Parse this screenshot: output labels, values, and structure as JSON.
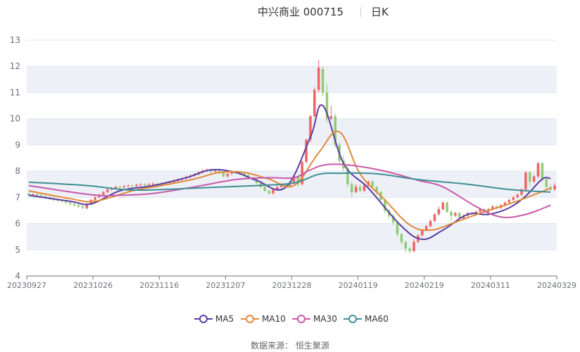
{
  "title": "中兴商业 000715",
  "subtitle": "日K",
  "source": "数据来源： 恒生聚源",
  "colors": {
    "up": "#ee6666",
    "down": "#91cc75",
    "MA5": "#5b3da1",
    "MA10": "#e08a3b",
    "MA30": "#c85aaa",
    "MA60": "#3f8f96",
    "band": "#eef0f7",
    "grid": "#e0e6f1",
    "axis": "#6e7079"
  },
  "chart_data": {
    "type": "candlestick",
    "ylim": [
      4,
      13
    ],
    "yticks": [
      4,
      5,
      6,
      7,
      8,
      9,
      10,
      11,
      12,
      13
    ],
    "xticks": [
      "20230927",
      "20231026",
      "20231116",
      "20231207",
      "20231228",
      "20240119",
      "20240219",
      "20240311",
      "20240329"
    ],
    "grid": true,
    "legend_position": "bottom",
    "candles": [
      [
        7.15,
        7.1,
        7.18,
        7.05
      ],
      [
        7.1,
        7.12,
        7.16,
        7.05
      ],
      [
        7.12,
        7.08,
        7.15,
        7.02
      ],
      [
        7.08,
        7.05,
        7.12,
        7.0
      ],
      [
        7.05,
        7.0,
        7.08,
        6.95
      ],
      [
        7.0,
        6.95,
        7.05,
        6.9
      ],
      [
        6.95,
        6.9,
        7.0,
        6.85
      ],
      [
        6.9,
        6.88,
        6.95,
        6.82
      ],
      [
        6.88,
        6.85,
        6.92,
        6.8
      ],
      [
        6.85,
        6.8,
        6.9,
        6.75
      ],
      [
        6.8,
        6.75,
        6.85,
        6.7
      ],
      [
        6.75,
        6.7,
        6.8,
        6.65
      ],
      [
        6.7,
        6.65,
        6.75,
        6.6
      ],
      [
        6.65,
        6.6,
        6.7,
        6.55
      ],
      [
        6.58,
        6.75,
        6.8,
        6.55
      ],
      [
        6.75,
        6.9,
        6.95,
        6.7
      ],
      [
        6.9,
        7.0,
        7.05,
        6.85
      ],
      [
        7.0,
        7.1,
        7.15,
        6.95
      ],
      [
        7.1,
        7.2,
        7.25,
        7.05
      ],
      [
        7.2,
        7.3,
        7.35,
        7.15
      ],
      [
        7.3,
        7.35,
        7.4,
        7.25
      ],
      [
        7.35,
        7.4,
        7.45,
        7.3
      ],
      [
        7.4,
        7.38,
        7.45,
        7.33
      ],
      [
        7.38,
        7.42,
        7.48,
        7.33
      ],
      [
        7.42,
        7.45,
        7.5,
        7.38
      ],
      [
        7.45,
        7.43,
        7.5,
        7.38
      ],
      [
        7.43,
        7.48,
        7.52,
        7.4
      ],
      [
        7.48,
        7.5,
        7.55,
        7.43
      ],
      [
        7.5,
        7.47,
        7.55,
        7.42
      ],
      [
        7.47,
        7.5,
        7.55,
        7.43
      ],
      [
        7.5,
        7.52,
        7.58,
        7.45
      ],
      [
        7.52,
        7.48,
        7.56,
        7.44
      ],
      [
        7.48,
        7.52,
        7.56,
        7.45
      ],
      [
        7.52,
        7.55,
        7.6,
        7.48
      ],
      [
        7.55,
        7.58,
        7.63,
        7.5
      ],
      [
        7.58,
        7.62,
        7.68,
        7.53
      ],
      [
        7.62,
        7.68,
        7.72,
        7.57
      ],
      [
        7.68,
        7.72,
        7.78,
        7.62
      ],
      [
        7.72,
        7.78,
        7.83,
        7.67
      ],
      [
        7.78,
        7.82,
        7.88,
        7.73
      ],
      [
        7.82,
        7.88,
        7.93,
        7.77
      ],
      [
        7.88,
        7.95,
        8.0,
        7.83
      ],
      [
        7.95,
        8.02,
        8.07,
        7.9
      ],
      [
        8.02,
        8.05,
        8.1,
        7.97
      ],
      [
        8.05,
        7.98,
        8.1,
        7.93
      ],
      [
        7.98,
        8.02,
        8.08,
        7.93
      ],
      [
        8.02,
        7.95,
        8.07,
        7.88
      ],
      [
        7.95,
        7.8,
        7.98,
        7.75
      ],
      [
        7.8,
        7.9,
        7.95,
        7.75
      ],
      [
        7.9,
        7.98,
        8.03,
        7.85
      ],
      [
        7.98,
        7.95,
        8.02,
        7.9
      ],
      [
        7.95,
        7.9,
        8.0,
        7.85
      ],
      [
        7.9,
        7.85,
        7.95,
        7.8
      ],
      [
        7.85,
        7.75,
        7.9,
        7.7
      ],
      [
        7.75,
        7.7,
        7.8,
        7.65
      ],
      [
        7.7,
        7.55,
        7.75,
        7.5
      ],
      [
        7.55,
        7.4,
        7.6,
        7.35
      ],
      [
        7.4,
        7.25,
        7.45,
        7.2
      ],
      [
        7.25,
        7.15,
        7.3,
        7.1
      ],
      [
        7.15,
        7.3,
        7.35,
        7.1
      ],
      [
        7.3,
        7.4,
        7.45,
        7.25
      ],
      [
        7.4,
        7.5,
        7.55,
        7.35
      ],
      [
        7.5,
        7.45,
        7.55,
        7.4
      ],
      [
        7.45,
        7.55,
        7.6,
        7.4
      ],
      [
        7.55,
        7.8,
        7.85,
        7.5
      ],
      [
        7.8,
        7.5,
        7.85,
        7.4
      ],
      [
        7.5,
        8.35,
        8.4,
        7.45
      ],
      [
        8.35,
        9.2,
        9.25,
        8.3
      ],
      [
        9.2,
        10.1,
        10.15,
        9.1
      ],
      [
        10.1,
        11.1,
        11.2,
        10.05
      ],
      [
        11.1,
        11.95,
        12.25,
        11.0
      ],
      [
        11.9,
        11.0,
        12.0,
        10.85
      ],
      [
        11.0,
        10.0,
        11.35,
        9.85
      ],
      [
        10.0,
        10.1,
        10.5,
        9.95
      ],
      [
        10.1,
        9.0,
        10.2,
        8.9
      ],
      [
        9.0,
        8.4,
        9.1,
        8.3
      ],
      [
        8.4,
        8.1,
        8.6,
        8.0
      ],
      [
        8.1,
        7.5,
        8.2,
        7.4
      ],
      [
        7.5,
        7.2,
        7.6,
        7.0
      ],
      [
        7.2,
        7.4,
        7.5,
        7.15
      ],
      [
        7.4,
        7.25,
        7.5,
        7.2
      ],
      [
        7.25,
        7.45,
        7.55,
        7.2
      ],
      [
        7.45,
        7.6,
        7.65,
        7.4
      ],
      [
        7.6,
        7.4,
        7.65,
        7.35
      ],
      [
        7.4,
        7.2,
        7.45,
        7.1
      ],
      [
        7.2,
        6.9,
        7.25,
        6.85
      ],
      [
        6.9,
        6.5,
        6.95,
        6.4
      ],
      [
        6.5,
        6.3,
        6.55,
        6.2
      ],
      [
        6.3,
        6.05,
        6.35,
        5.95
      ],
      [
        6.05,
        5.6,
        6.1,
        5.5
      ],
      [
        5.6,
        5.3,
        5.65,
        5.2
      ],
      [
        5.3,
        5.05,
        5.35,
        4.9
      ],
      [
        5.05,
        4.95,
        5.1,
        4.85
      ],
      [
        4.95,
        5.3,
        5.4,
        4.9
      ],
      [
        5.3,
        5.55,
        5.6,
        5.25
      ],
      [
        5.55,
        5.75,
        5.8,
        5.5
      ],
      [
        5.75,
        5.9,
        5.95,
        5.7
      ],
      [
        5.9,
        6.1,
        6.15,
        5.85
      ],
      [
        6.1,
        6.35,
        6.4,
        6.05
      ],
      [
        6.35,
        6.55,
        6.65,
        6.3
      ],
      [
        6.55,
        6.8,
        6.85,
        6.5
      ],
      [
        6.8,
        6.45,
        6.85,
        6.4
      ],
      [
        6.45,
        6.3,
        6.5,
        6.1
      ],
      [
        6.3,
        6.4,
        6.45,
        6.25
      ],
      [
        6.4,
        6.2,
        6.45,
        6.15
      ],
      [
        6.2,
        6.3,
        6.35,
        6.15
      ],
      [
        6.3,
        6.4,
        6.45,
        6.25
      ],
      [
        6.4,
        6.35,
        6.45,
        6.3
      ],
      [
        6.35,
        6.45,
        6.5,
        6.3
      ],
      [
        6.45,
        6.55,
        6.6,
        6.4
      ],
      [
        6.55,
        6.45,
        6.6,
        6.4
      ],
      [
        6.45,
        6.55,
        6.6,
        6.4
      ],
      [
        6.55,
        6.65,
        6.7,
        6.5
      ],
      [
        6.65,
        6.6,
        6.7,
        6.55
      ],
      [
        6.6,
        6.7,
        6.75,
        6.55
      ],
      [
        6.7,
        6.8,
        6.85,
        6.65
      ],
      [
        6.8,
        6.9,
        6.95,
        6.75
      ],
      [
        6.9,
        7.0,
        7.05,
        6.85
      ],
      [
        7.0,
        7.1,
        7.15,
        6.95
      ],
      [
        7.1,
        7.3,
        7.35,
        7.05
      ],
      [
        7.3,
        7.95,
        8.0,
        7.25
      ],
      [
        7.95,
        7.6,
        8.0,
        7.4
      ],
      [
        7.6,
        7.8,
        7.85,
        7.55
      ],
      [
        7.8,
        8.3,
        8.35,
        7.75
      ],
      [
        8.3,
        7.7,
        8.35,
        7.6
      ],
      [
        7.7,
        7.4,
        7.75,
        7.3
      ],
      [
        7.4,
        7.3,
        7.5,
        7.25
      ],
      [
        7.3,
        7.45,
        7.55,
        7.25
      ]
    ],
    "series": [
      {
        "name": "MA5",
        "x": [
          0,
          10,
          15,
          22,
          30,
          38,
          44,
          50,
          55,
          62,
          68,
          71,
          76,
          82,
          90,
          95,
          100,
          106,
          111,
          116,
          120,
          124,
          126
        ],
        "values": [
          7.08,
          6.85,
          6.75,
          7.25,
          7.45,
          7.75,
          8.05,
          7.95,
          7.65,
          7.38,
          9.3,
          10.5,
          8.3,
          7.35,
          5.9,
          5.4,
          5.75,
          6.35,
          6.35,
          6.6,
          7.05,
          7.7,
          7.72
        ]
      },
      {
        "name": "MA10",
        "x": [
          0,
          10,
          16,
          25,
          32,
          40,
          46,
          52,
          58,
          64,
          70,
          75,
          80,
          86,
          92,
          97,
          103,
          110,
          116,
          122,
          126
        ],
        "values": [
          7.25,
          6.95,
          6.85,
          7.25,
          7.45,
          7.7,
          7.95,
          7.95,
          7.7,
          7.45,
          8.7,
          9.5,
          7.9,
          6.9,
          5.95,
          5.75,
          6.05,
          6.45,
          6.75,
          7.1,
          7.35
        ]
      },
      {
        "name": "MA30",
        "x": [
          0,
          15,
          22,
          30,
          40,
          50,
          58,
          64,
          68,
          72,
          78,
          86,
          94,
          100,
          108,
          114,
          120,
          126
        ],
        "values": [
          7.45,
          7.1,
          7.08,
          7.15,
          7.4,
          7.68,
          7.75,
          7.75,
          8.05,
          8.25,
          8.22,
          8.0,
          7.65,
          7.4,
          6.65,
          6.25,
          6.35,
          6.7
        ]
      },
      {
        "name": "MA60",
        "x": [
          0,
          14,
          25,
          40,
          55,
          64,
          70,
          75,
          84,
          94,
          106,
          116,
          126
        ],
        "values": [
          7.58,
          7.45,
          7.28,
          7.35,
          7.45,
          7.55,
          7.88,
          7.92,
          7.9,
          7.68,
          7.5,
          7.3,
          7.2
        ]
      }
    ]
  },
  "legend": [
    {
      "name": "MA5"
    },
    {
      "name": "MA10"
    },
    {
      "name": "MA30"
    },
    {
      "name": "MA60"
    }
  ]
}
